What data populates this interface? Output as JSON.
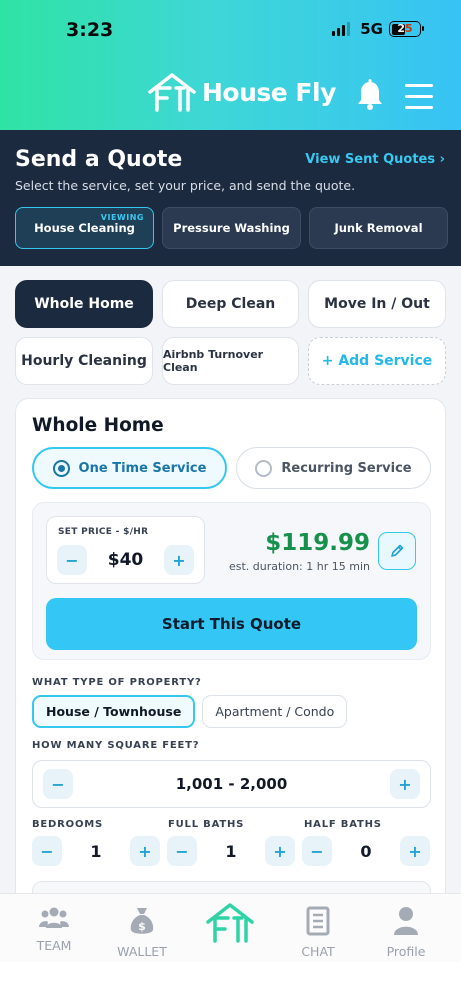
{
  "status_bar": {
    "time": "3:23",
    "network": "5G",
    "battery": "25"
  },
  "header": {
    "logo_text": "House Fly",
    "icons": [
      "bell-icon",
      "menu-icon"
    ]
  },
  "quote": {
    "title": "Send a Quote",
    "subtitle": "Select the service, set your price, and send the quote.",
    "view_sent_link": "View Sent Quotes ›",
    "categories": [
      {
        "label": "House Cleaning",
        "badge": "VIEWING",
        "active": true
      },
      {
        "label": "Pressure Washing",
        "active": false
      },
      {
        "label": "Junk Removal",
        "active": false
      }
    ]
  },
  "services": [
    {
      "label": "Whole Home",
      "active": true
    },
    {
      "label": "Deep Clean"
    },
    {
      "label": "Move In / Out"
    },
    {
      "label": "Hourly Cleaning"
    },
    {
      "label": "Airbnb Turnover Clean"
    },
    {
      "label": "+ Add Service"
    }
  ],
  "card": {
    "title": "Whole Home",
    "frequency": {
      "one_time": "One Time Service",
      "recurring": "Recurring Service",
      "selected": "One Time Service"
    },
    "pricing": {
      "set_price_label": "SET PRICE - $/HR",
      "rate": "$40",
      "minus": "−",
      "plus": "+",
      "total": "$119.99",
      "duration": "est. duration: 1 hr 15 min",
      "start_button": "Start This Quote"
    },
    "property": {
      "label": "WHAT TYPE OF PROPERTY?",
      "options": [
        "House / Townhouse",
        "Apartment / Condo"
      ],
      "selected": "House / Townhouse"
    },
    "square_feet": {
      "label": "HOW MANY SQUARE FEET?",
      "value": "1,001 - 2,000"
    },
    "rooms": {
      "bedrooms_label": "BEDROOMS",
      "bedrooms": "1",
      "full_baths_label": "FULL BATHS",
      "full_baths": "1",
      "half_baths_label": "HALF BATHS",
      "half_baths": "0"
    }
  },
  "bottom_nav": {
    "team": "TEAM",
    "wallet": "WALLET",
    "chat": "CHAT",
    "profile": "Profile"
  },
  "colors": {
    "accent": "#34c6f4",
    "dark_navy": "#1c2a3f",
    "price_green": "#15914b",
    "gradient_start": "#2fe3a4",
    "gradient_end": "#37c3f5"
  }
}
